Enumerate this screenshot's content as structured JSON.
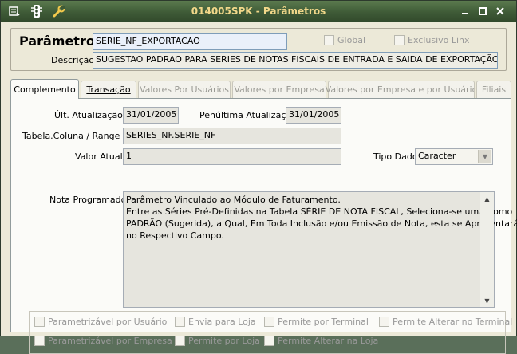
{
  "window": {
    "title": "014005SPK - Parâmetros",
    "icons": [
      "menu-icon",
      "traffic-light-icon",
      "wrench-icon"
    ],
    "controls": {
      "minimize": "▬",
      "maximize": "□",
      "close": "✕"
    }
  },
  "header": {
    "parametro_label": "Parâmetro",
    "parametro_value": "SERIE_NF_EXPORTACAO",
    "global_label": "Global",
    "exclusivo_label": "Exclusivo Linx",
    "descricao_label": "Descrição",
    "descricao_value": "SUGESTAO PADRAO PARA SERIES DE NOTAS FISCAIS DE ENTRADA E SAIDA DE EXPORTAÇÃO"
  },
  "tabs": [
    {
      "label": "Complemento",
      "state": "active"
    },
    {
      "label": "Transação",
      "state": "enabled"
    },
    {
      "label": "Valores Por Usuários",
      "state": "disabled"
    },
    {
      "label": "Valores por Empresa",
      "state": "disabled"
    },
    {
      "label": "Valores por Empresa e por Usuário",
      "state": "disabled"
    },
    {
      "label": "Filiais",
      "state": "disabled"
    }
  ],
  "complemento": {
    "ult_atualizacao_label": "Últ. Atualização",
    "ult_atualizacao_value": "31/01/2005",
    "penultima_label": "Penúltima Atualização",
    "penultima_value": "31/01/2005",
    "tabela_label": "Tabela.Coluna / Range",
    "tabela_value": "SERIES_NF.SERIE_NF",
    "valor_label": "Valor Atual",
    "valor_value": "1",
    "tipo_label": "Tipo Dado",
    "tipo_value": "Caracter",
    "nota_label": "Nota Programador",
    "nota_lines": [
      "Parâmetro Vinculado ao Módulo de Faturamento.",
      "Entre as Séries Pré-Definidas na Tabela  SÉRIE DE NOTA FISCAL, Seleciona-se uma Como",
      "PADRÃO (Sugerida), a Qual, Em Toda Inclusão e/ou Emissão de Nota, esta se Apresentará",
      "no Respectivo Campo."
    ]
  },
  "options": {
    "parametrizavel_usuario": "Parametrizável por Usuário",
    "envia_loja": "Envia para Loja",
    "permite_terminal": "Permite por Terminal",
    "permite_alterar_terminal": "Permite Alterar no Terminal",
    "parametrizavel_empresa": "Parametrizável por Empresa",
    "permite_loja": "Permite por Loja",
    "permite_alterar_loja": "Permite Alterar na Loja"
  }
}
